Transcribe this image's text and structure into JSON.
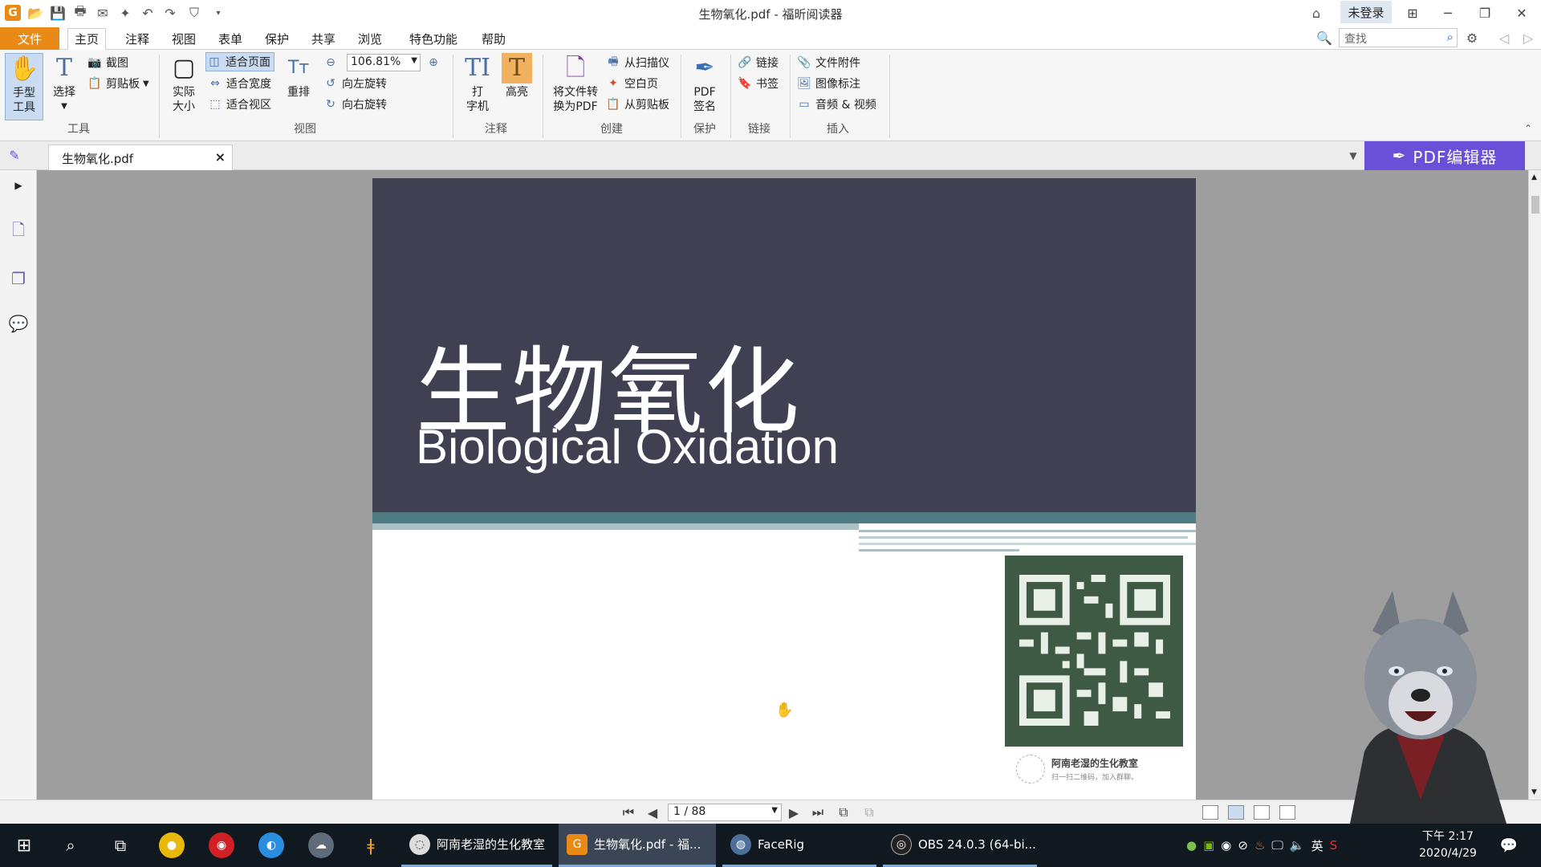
{
  "window": {
    "title": "生物氧化.pdf - 福昕阅读器",
    "login": "未登录"
  },
  "menu": {
    "tabs": [
      "文件",
      "主页",
      "注释",
      "视图",
      "表单",
      "保护",
      "共享",
      "浏览",
      "特色功能",
      "帮助"
    ],
    "search_placeholder": "查找"
  },
  "ribbon": {
    "tools": {
      "hand": "手型\n工具",
      "select": "选择",
      "screenshot": "截图",
      "clipboard": "剪贴板",
      "label": "工具"
    },
    "view": {
      "actual_size": "实际\n大小",
      "fit_page": "适合页面",
      "fit_width": "适合宽度",
      "fit_visible": "适合视区",
      "reflow": "重排",
      "zoom": "106.81%",
      "rotate_left": "向左旋转",
      "rotate_right": "向右旋转",
      "label": "视图"
    },
    "comment": {
      "typewriter": "打\n字机",
      "highlight": "高亮",
      "label": "注释"
    },
    "create": {
      "to_pdf": "将文件转\n换为PDF",
      "from_scanner": "从扫描仪",
      "blank_page": "空白页",
      "from_clipboard": "从剪贴板",
      "label": "创建"
    },
    "protect": {
      "sign": "PDF\n签名",
      "label": "保护"
    },
    "links": {
      "link": "链接",
      "bookmark": "书签",
      "label": "链接"
    },
    "insert": {
      "attachment": "文件附件",
      "image_annotation": "图像标注",
      "audio_video": "音频 & 视频",
      "label": "插入"
    }
  },
  "doc_tab": {
    "name": "生物氧化.pdf"
  },
  "pdf_editor": "PDF编辑器",
  "slide": {
    "title_cn": "生物氧化",
    "title_en": "Biological Oxidation",
    "qr_caption1": "阿南老湿的生化教室",
    "qr_caption2": "扫一扫二维码，加入群聊。"
  },
  "status": {
    "page": "1 / 88"
  },
  "taskbar": {
    "apps": [
      {
        "label": "阿南老湿的生化教室"
      },
      {
        "label": "生物氧化.pdf - 福..."
      },
      {
        "label": "FaceRig"
      },
      {
        "label": "OBS 24.0.3 (64-bi..."
      }
    ],
    "ime": "英",
    "time": "下午 2:17",
    "date": "2020/4/29"
  },
  "colors": {
    "accent_orange": "#e98a16",
    "slide_dark": "#3f4152",
    "slide_teal": "#4f7c82",
    "editor_purple": "#6a4fd8"
  }
}
